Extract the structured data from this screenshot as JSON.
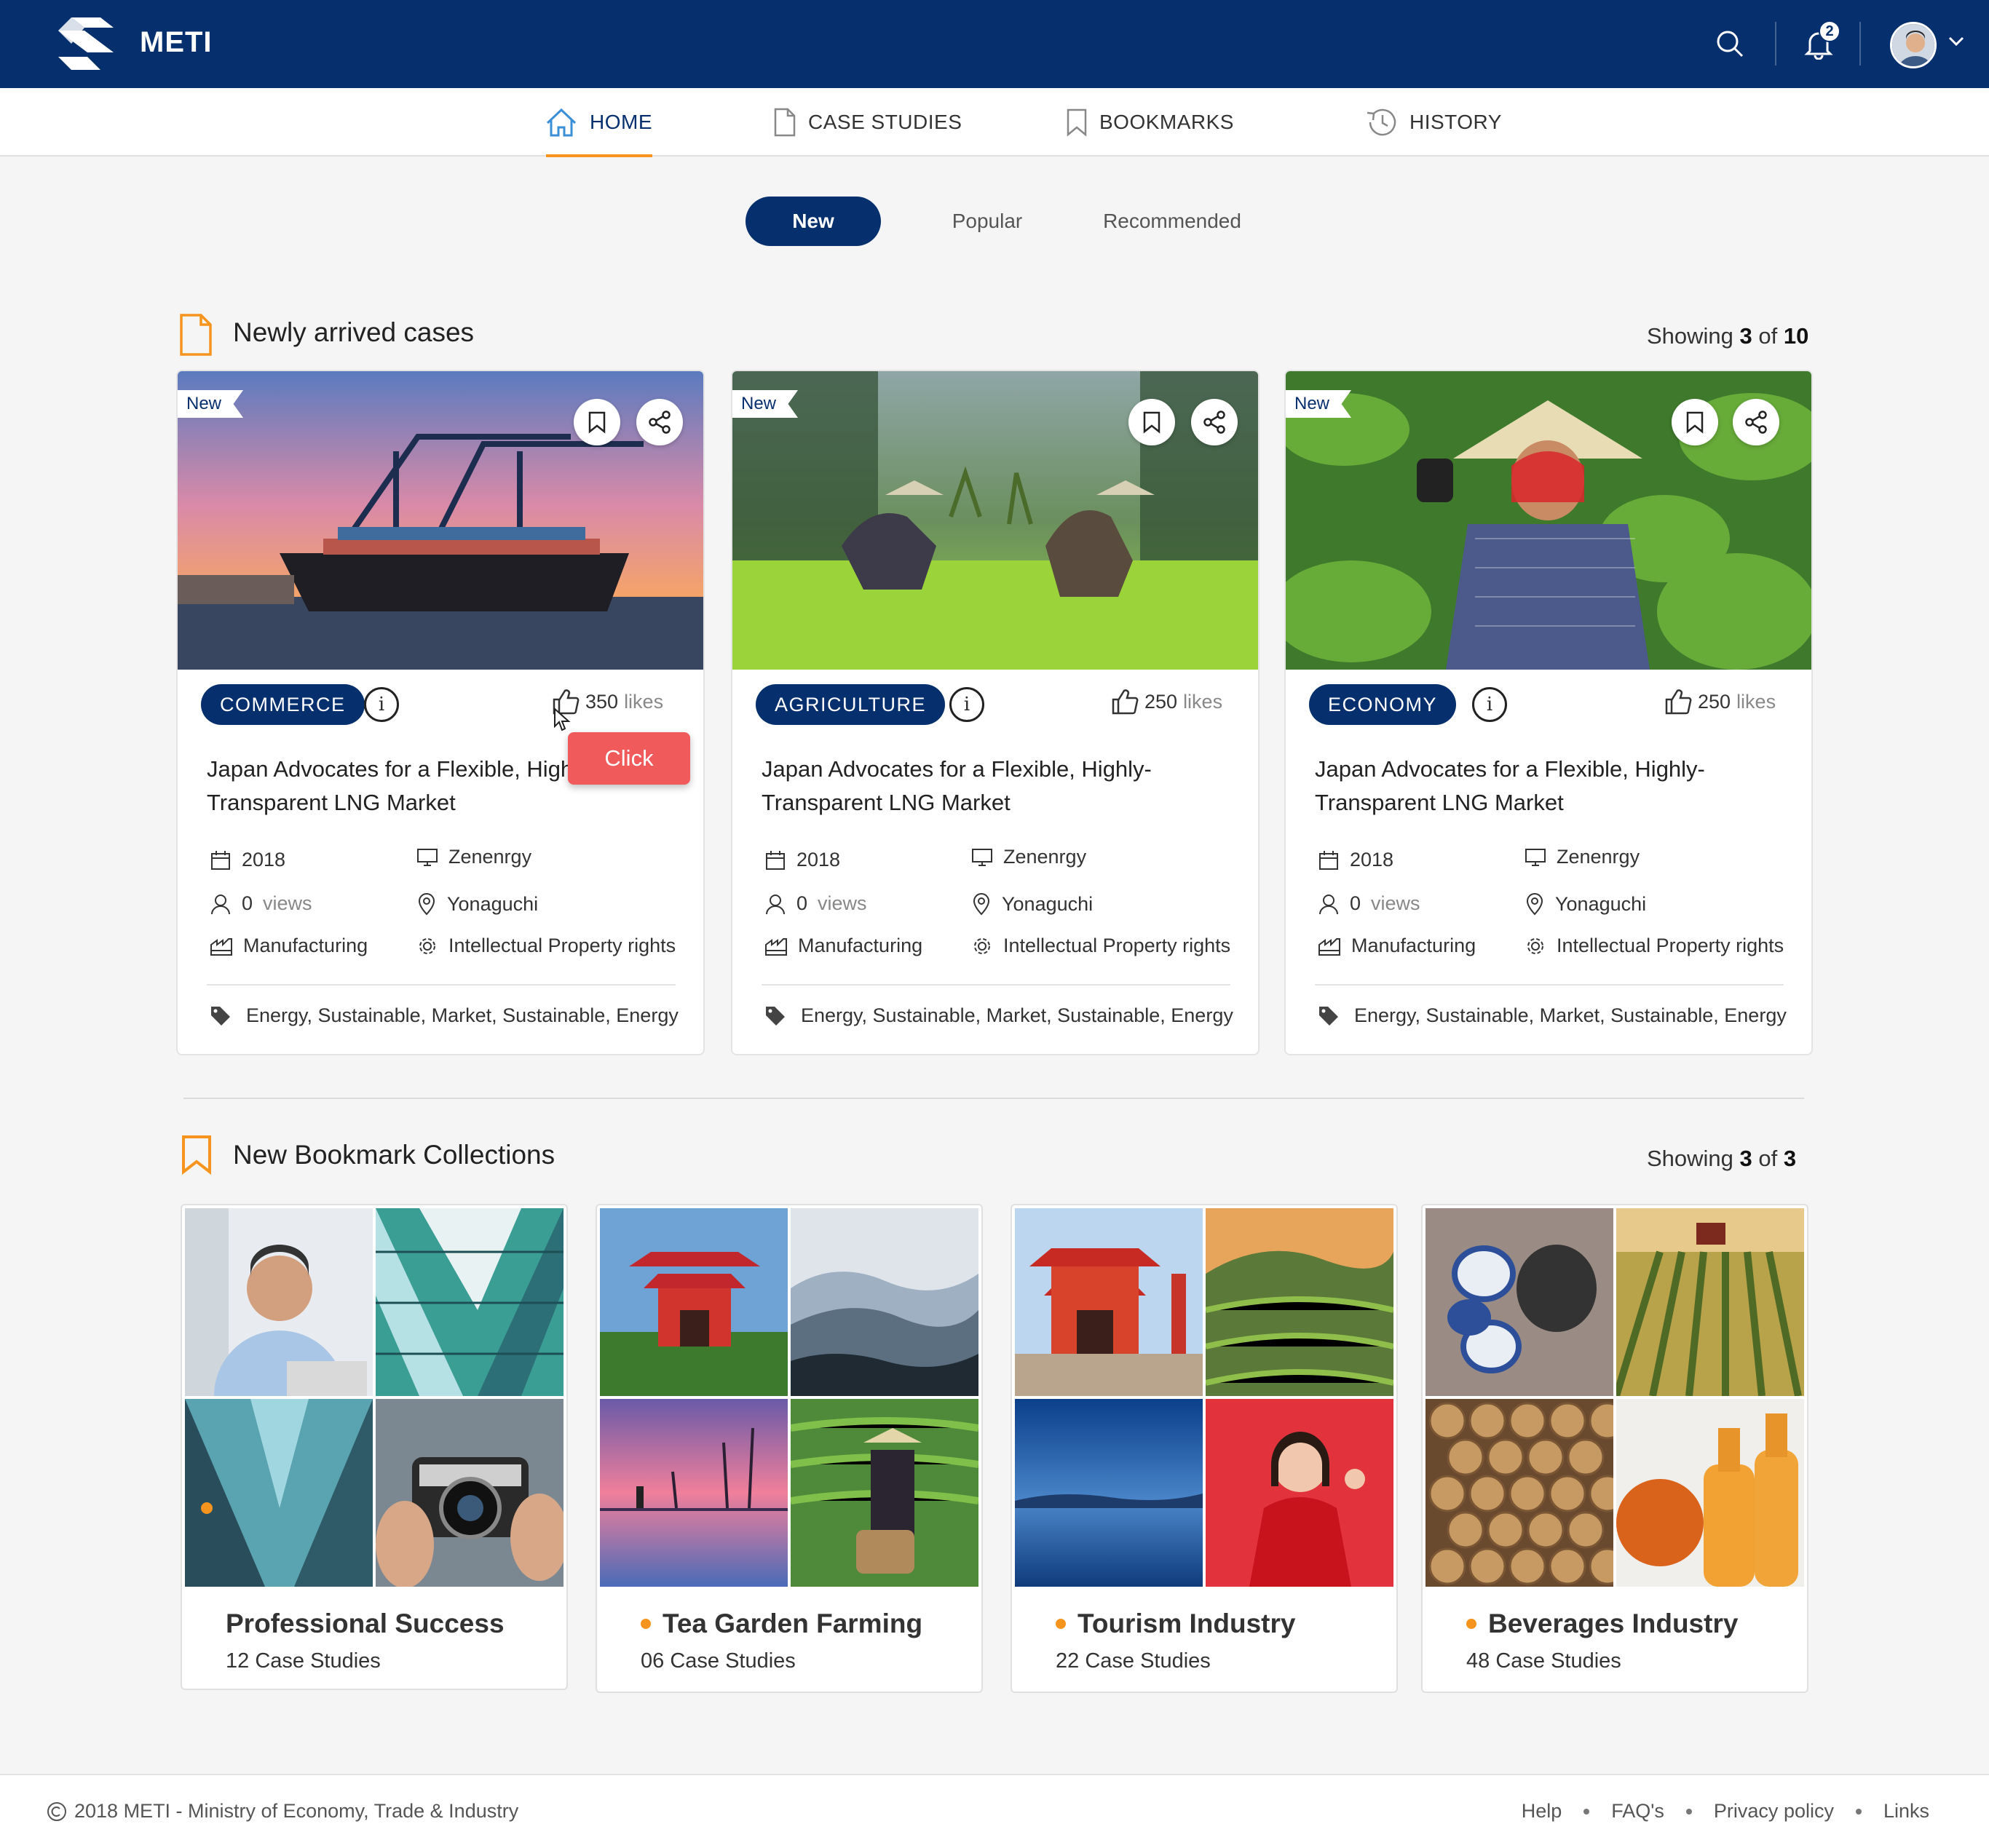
{
  "header": {
    "app_name": "METI",
    "notification_count": "2"
  },
  "nav": {
    "home": "HOME",
    "case_studies": "CASE STUDIES",
    "bookmarks": "BOOKMARKS",
    "history": "HISTORY"
  },
  "filters": {
    "new": "New",
    "popular": "Popular",
    "recommended": "Recommended"
  },
  "cases_section": {
    "title": "Newly arrived cases",
    "showing_prefix": "Showing",
    "shown": "3",
    "of_word": "of",
    "total": "10"
  },
  "cases": [
    {
      "tag": "New",
      "category": "COMMERCE",
      "likes": "350",
      "likes_unit": "likes",
      "title": "Japan Advocates for a Flexible, Highly-Transparent LNG Market",
      "year": "2018",
      "company": "Zenenrgy",
      "views": "0",
      "views_unit": "views",
      "location": "Yonaguchi",
      "industry": "Manufacturing",
      "topic": "Intellectual Property rights",
      "tags": "Energy, Sustainable, Market, Sustainable, Energy"
    },
    {
      "tag": "New",
      "category": "AGRICULTURE",
      "likes": "250",
      "likes_unit": "likes",
      "title": "Japan Advocates for a Flexible, Highly-Transparent LNG Market",
      "year": "2018",
      "company": "Zenenrgy",
      "views": "0",
      "views_unit": "views",
      "location": "Yonaguchi",
      "industry": "Manufacturing",
      "topic": "Intellectual Property rights",
      "tags": "Energy, Sustainable, Market, Sustainable, Energy"
    },
    {
      "tag": "New",
      "category": "ECONOMY",
      "likes": "250",
      "likes_unit": "likes",
      "title": "Japan Advocates for a Flexible, Highly-Transparent LNG Market",
      "year": "2018",
      "company": "Zenenrgy",
      "views": "0",
      "views_unit": "views",
      "location": "Yonaguchi",
      "industry": "Manufacturing",
      "topic": "Intellectual Property rights",
      "tags": "Energy, Sustainable, Market, Sustainable, Energy"
    }
  ],
  "click_label": "Click",
  "bookmarks_section": {
    "title": "New Bookmark Collections",
    "showing_prefix": "Showing",
    "shown": "3",
    "of_word": "of",
    "total": "3"
  },
  "collections": [
    {
      "title": "Professional Success",
      "count": "12 Case Studies"
    },
    {
      "title": "Tea Garden Farming",
      "count": "06 Case Studies"
    },
    {
      "title": "Tourism Industry",
      "count": "22 Case Studies"
    },
    {
      "title": "Beverages Industry",
      "count": "48 Case Studies"
    }
  ],
  "footer": {
    "copyright": "2018 METI - Ministry of Economy, Trade & Industry",
    "links": [
      "Help",
      "FAQ's",
      "Privacy policy",
      "Links"
    ]
  },
  "colors": {
    "primary": "#062f6e",
    "accent": "#f7941d",
    "click": "#f05a5a"
  }
}
